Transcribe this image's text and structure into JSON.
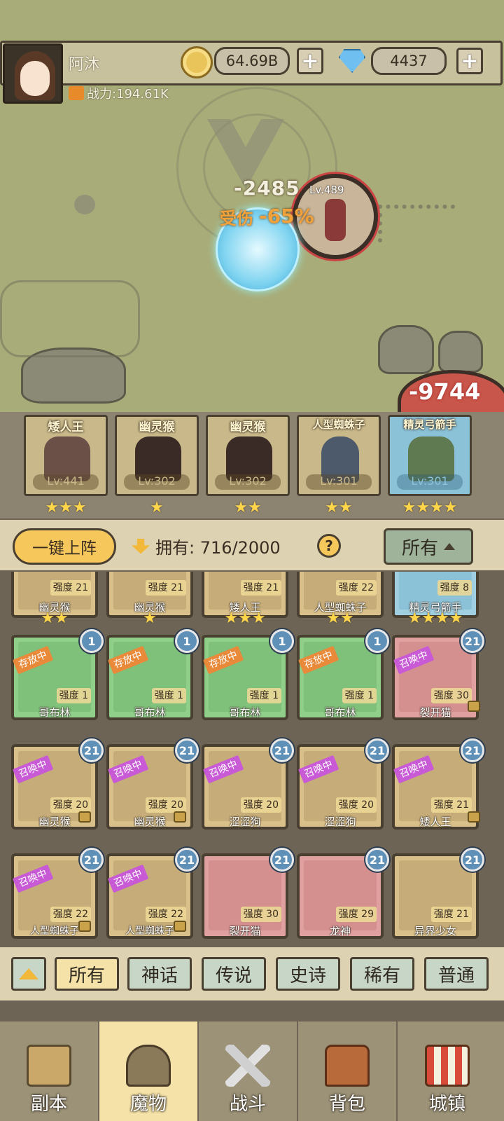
{
  "player": {
    "name": "阿沐",
    "power": "战力:194.61K"
  },
  "currency": {
    "gold": "64.69B",
    "gems": "4437",
    "plus": "+"
  },
  "battle": {
    "damage1": "-2485",
    "damage2": "-9744",
    "hurt_label": "受伤",
    "hurt_pct": "-65%",
    "enemy_level": "Lv.489"
  },
  "team": [
    {
      "name": "矮人王",
      "level": "Lv:441",
      "stars": "★★★"
    },
    {
      "name": "幽灵猴",
      "level": "Lv:302",
      "stars": "★"
    },
    {
      "name": "幽灵猴",
      "level": "Lv:302",
      "stars": "★★"
    },
    {
      "name": "人型蜘蛛子",
      "level": "Lv:301",
      "stars": "★★"
    },
    {
      "name": "精灵弓箭手",
      "level": "Lv:301",
      "stars": "★★★★"
    }
  ],
  "bar": {
    "onekey": "一键上阵",
    "owned": "拥有: 716/2000",
    "help": "?",
    "filter_selected": "所有"
  },
  "row0": [
    {
      "name": "幽灵猴",
      "strength": "强度 21",
      "stars": "★★"
    },
    {
      "name": "幽灵猴",
      "strength": "强度 21",
      "stars": "★"
    },
    {
      "name": "矮人王",
      "strength": "强度 21",
      "stars": "★★★"
    },
    {
      "name": "人型蜘蛛子",
      "strength": "强度 22",
      "stars": "★★"
    },
    {
      "name": "精灵弓箭手",
      "strength": "强度 8",
      "stars": "★★★★"
    }
  ],
  "row1": [
    {
      "name": "哥布林",
      "strength": "强度 1",
      "badge": "1",
      "ribbon": "存放中"
    },
    {
      "name": "哥布林",
      "strength": "强度 1",
      "badge": "1",
      "ribbon": "存放中"
    },
    {
      "name": "哥布林",
      "strength": "强度 1",
      "badge": "1",
      "ribbon": "存放中"
    },
    {
      "name": "哥布林",
      "strength": "强度 1",
      "badge": "1",
      "ribbon": "存放中"
    },
    {
      "name": "裂开猫",
      "strength": "强度 30",
      "badge": "21",
      "ribbon": "召唤中"
    }
  ],
  "row2": [
    {
      "name": "幽灵猴",
      "strength": "强度 20",
      "badge": "21",
      "ribbon": "召唤中"
    },
    {
      "name": "幽灵猴",
      "strength": "强度 20",
      "badge": "21",
      "ribbon": "召唤中"
    },
    {
      "name": "涩涩狗",
      "strength": "强度 20",
      "badge": "21",
      "ribbon": "召唤中"
    },
    {
      "name": "涩涩狗",
      "strength": "强度 20",
      "badge": "21",
      "ribbon": "召唤中"
    },
    {
      "name": "矮人王",
      "strength": "强度 21",
      "badge": "21",
      "ribbon": "召唤中"
    }
  ],
  "row3": [
    {
      "name": "人型蜘蛛子",
      "strength": "强度 22",
      "badge": "21",
      "ribbon": "召唤中"
    },
    {
      "name": "人型蜘蛛子",
      "strength": "强度 22",
      "badge": "21",
      "ribbon": "召唤中"
    },
    {
      "name": "裂开猫",
      "strength": "强度 30",
      "badge": "21",
      "ribbon": ""
    },
    {
      "name": "龙神",
      "strength": "强度 29",
      "badge": "21",
      "ribbon": ""
    },
    {
      "name": "异界少女",
      "strength": "强度 21",
      "badge": "21",
      "ribbon": ""
    }
  ],
  "filters": [
    "所有",
    "神话",
    "传说",
    "史诗",
    "稀有",
    "普通"
  ],
  "nav": [
    "副本",
    "魔物",
    "战斗",
    "背包",
    "城镇"
  ],
  "colors": {
    "ribbon_store": "#e98a3a",
    "ribbon_summon": "#c85ad6",
    "badge": "#5e90b8",
    "nav_active": "#f4e2a8"
  }
}
